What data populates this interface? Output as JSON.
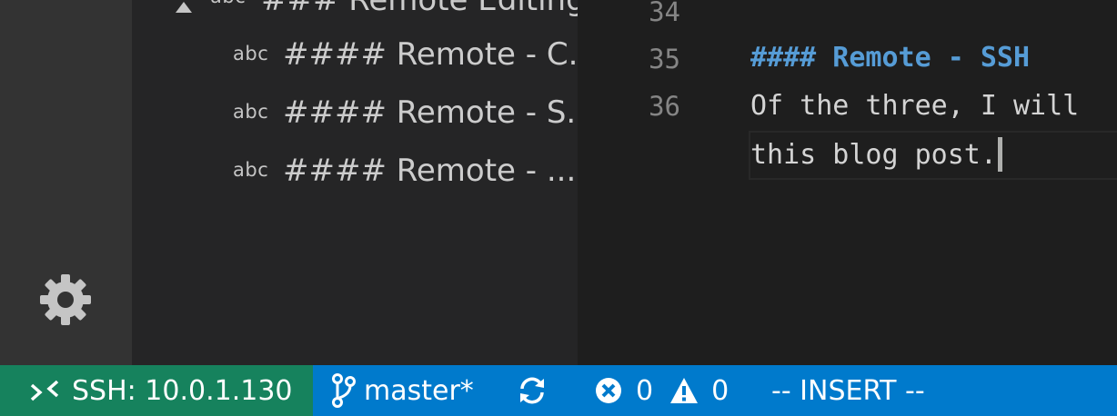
{
  "outline": {
    "parent": {
      "kind": "abc",
      "label": "### Remote Editing"
    },
    "items": [
      {
        "kind": "abc",
        "label": "#### Remote - C..."
      },
      {
        "kind": "abc",
        "label": "#### Remote - S..."
      },
      {
        "kind": "abc",
        "label": "#### Remote - ..."
      }
    ]
  },
  "editor": {
    "line_numbers": [
      "34",
      "35",
      "36"
    ],
    "lines": {
      "heading": "#### Remote - SSH",
      "text1": "Of the three, I will",
      "text2": "this blog post."
    }
  },
  "statusbar": {
    "remote": "SSH: 10.0.1.130",
    "branch": "master*",
    "errors": "0",
    "warnings": "0",
    "mode": "-- INSERT --"
  },
  "colors": {
    "activity_bar": "#333333",
    "sidebar": "#252526",
    "editor": "#1e1e1e",
    "statusbar": "#007acc",
    "remote_indicator": "#16825d",
    "markdown_heading": "#569cd6"
  },
  "icons": [
    "gear-icon",
    "remote-icon",
    "git-branch-icon",
    "sync-icon",
    "error-icon",
    "warning-icon"
  ]
}
